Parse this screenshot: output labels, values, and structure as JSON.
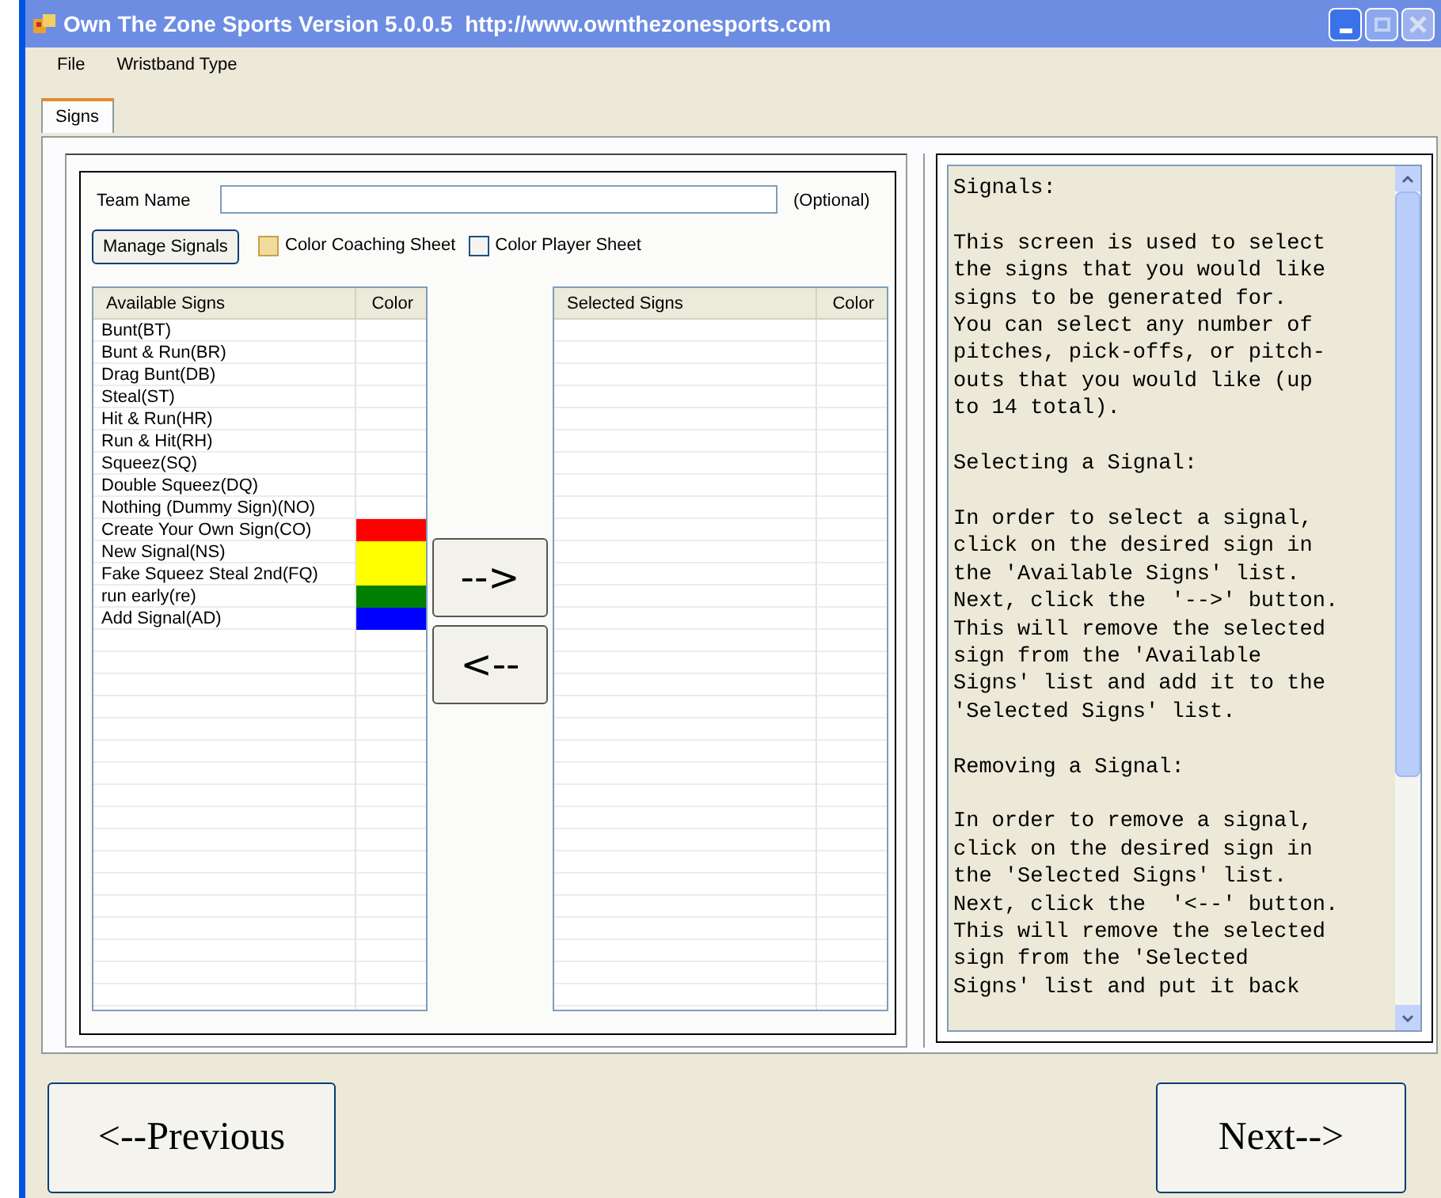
{
  "window": {
    "title": "Own The Zone Sports Version 5.0.0.5  http://www.ownthezonesports.com"
  },
  "menu": [
    "File",
    "Wristband Type"
  ],
  "tabs": [
    {
      "label": "Signs",
      "selected": true
    }
  ],
  "team_name": {
    "label": "Team Name",
    "hint": "(Optional)"
  },
  "manage_button": "Manage Signals",
  "checkboxes": [
    {
      "label": "Color Coaching Sheet",
      "checked": false,
      "disabled": true
    },
    {
      "label": "Color Player Sheet",
      "checked": false,
      "disabled": false
    }
  ],
  "available": {
    "columns": [
      "Available Signs",
      "Color"
    ],
    "rows": [
      {
        "name": "Bunt(BT)"
      },
      {
        "name": "Bunt & Run(BR)"
      },
      {
        "name": "Drag Bunt(DB)"
      },
      {
        "name": "Steal(ST)"
      },
      {
        "name": "Hit & Run(HR)"
      },
      {
        "name": "Run & Hit(RH)"
      },
      {
        "name": "Squeez(SQ)"
      },
      {
        "name": "Double Squeez(DQ)"
      },
      {
        "name": "Nothing (Dummy Sign)(NO)"
      },
      {
        "name": "Create Your Own Sign(CO)",
        "color": "#ff0000"
      },
      {
        "name": "New Signal(NS)",
        "color": "#ffff00"
      },
      {
        "name": "Fake Squeez Steal 2nd(FQ)",
        "color": "#ffff00"
      },
      {
        "name": "run early(re)",
        "color": "#008000"
      },
      {
        "name": "Add Signal(AD)",
        "color": "#0000ff"
      }
    ]
  },
  "move_buttons": [
    "-->",
    "<--"
  ],
  "selected": {
    "columns": [
      "Selected Signs",
      "Color"
    ]
  },
  "help_text": "Signals:\n\nThis screen is used to select\nthe signs that you would like\nsigns to be generated for.\nYou can select any number of\npitches, pick-offs, or pitch-\nouts that you would like (up\nto 14 total).\n\nSelecting a Signal:\n\nIn order to select a signal,\nclick on the desired sign in\nthe 'Available Signs' list.\nNext, click the  '-->' button.\nThis will remove the selected\nsign from the 'Available\nSigns' list and add it to the\n'Selected Signs' list.\n\nRemoving a Signal:\n\nIn order to remove a signal,\nclick on the desired sign in\nthe 'Selected Signs' list.\nNext, click the  '<--' button.\nThis will remove the selected\nsign from the 'Selected\nSigns' list and put it back",
  "nav": {
    "previous": "<--Previous",
    "next": "Next-->"
  }
}
